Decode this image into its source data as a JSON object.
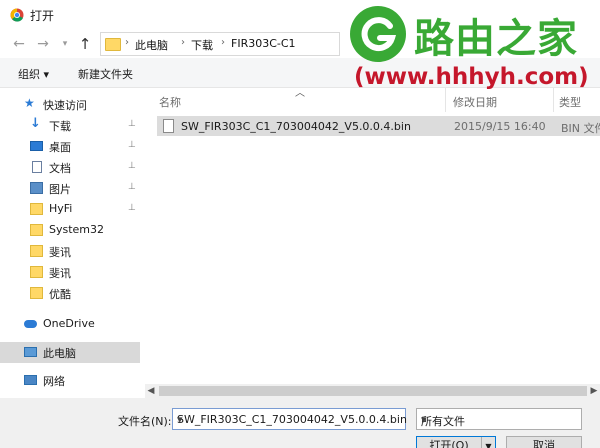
{
  "window": {
    "title": "打开"
  },
  "nav": {
    "back_icon": "arrow-left-icon",
    "forward_icon": "arrow-right-icon",
    "history_icon": "chevron-down-icon",
    "up_icon": "arrow-up-icon",
    "breadcrumbs": [
      "此电脑",
      "下载",
      "FIR303C-C1"
    ],
    "separator": "›"
  },
  "toolbar": {
    "organize_label": "组织 ▾",
    "new_folder_label": "新建文件夹"
  },
  "sidebar": {
    "items": [
      {
        "label": "快速访问",
        "icon": "star-icon",
        "pinned": false
      },
      {
        "label": "下载",
        "icon": "download-arrow-icon",
        "pinned": true
      },
      {
        "label": "桌面",
        "icon": "desktop-icon",
        "pinned": true
      },
      {
        "label": "文档",
        "icon": "document-icon",
        "pinned": true
      },
      {
        "label": "图片",
        "icon": "picture-icon",
        "pinned": true
      },
      {
        "label": "HyFi",
        "icon": "folder-icon",
        "pinned": true
      },
      {
        "label": "System32",
        "icon": "folder-icon",
        "pinned": false
      },
      {
        "label": "斐讯",
        "icon": "folder-icon",
        "pinned": false
      },
      {
        "label": "斐讯",
        "icon": "folder-icon",
        "pinned": false
      },
      {
        "label": "优酷",
        "icon": "folder-icon",
        "pinned": false
      },
      {
        "label": "OneDrive",
        "icon": "cloud-icon",
        "pinned": false
      },
      {
        "label": "此电脑",
        "icon": "computer-icon",
        "pinned": false,
        "selected": true
      },
      {
        "label": "网络",
        "icon": "network-icon",
        "pinned": false
      }
    ],
    "pin_glyph": "📌"
  },
  "filelist": {
    "columns": [
      "名称",
      "修改日期",
      "类型"
    ],
    "files": [
      {
        "name": "SW_FIR303C_C1_703004042_V5.0.0.4.bin",
        "date": "2015/9/15 16:40",
        "type": "BIN 文件",
        "selected": true
      }
    ]
  },
  "bottom": {
    "filename_label": "文件名(N):",
    "filename_value": "SW_FIR303C_C1_703004042_V5.0.0.4.bin",
    "filter_value": "所有文件",
    "open_label": "打开(O)",
    "cancel_label": "取消"
  },
  "watermark": {
    "name": "路由之家",
    "url": "(www.hhhyh.com)"
  },
  "colors": {
    "accent": "#0078d7",
    "watermark_green": "#39a935",
    "watermark_red": "#c5172b",
    "folder": "#ffd866"
  }
}
